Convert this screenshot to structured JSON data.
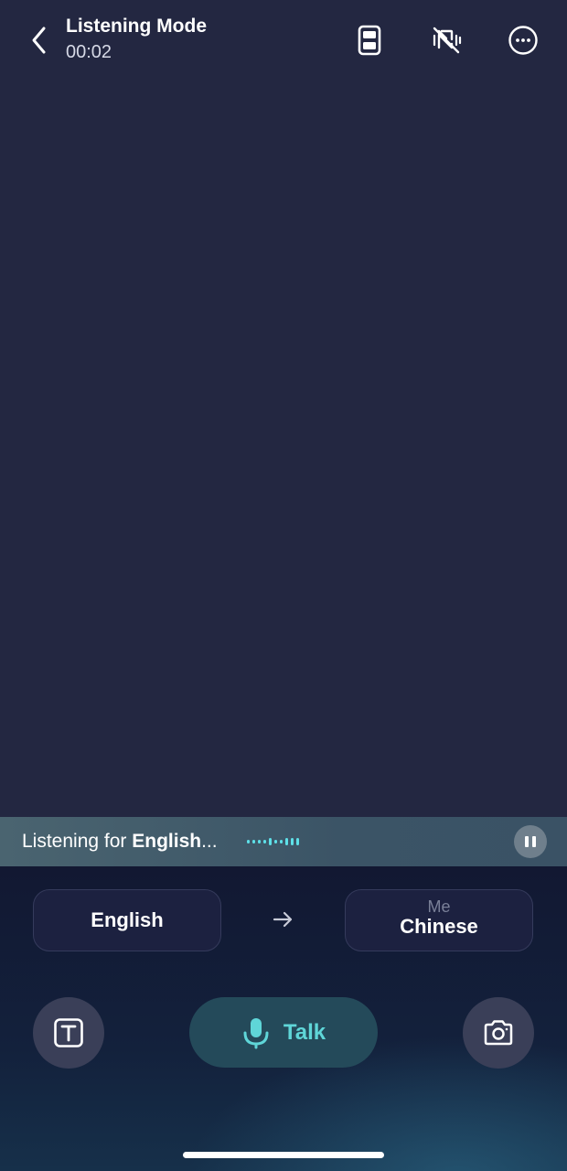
{
  "header": {
    "title": "Listening Mode",
    "timer": "00:02",
    "icons": [
      "back-chevron-icon",
      "split-layout-icon",
      "vibration-off-icon",
      "more-options-icon"
    ]
  },
  "listening": {
    "prefix": "Listening for ",
    "language": "English",
    "suffix": "...",
    "wave_color": "#5ee0e8"
  },
  "languages": {
    "source": {
      "label": "English"
    },
    "target": {
      "sub": "Me",
      "label": "Chinese"
    }
  },
  "actions": {
    "talk_label": "Talk",
    "accent": "#5fd6d8"
  }
}
